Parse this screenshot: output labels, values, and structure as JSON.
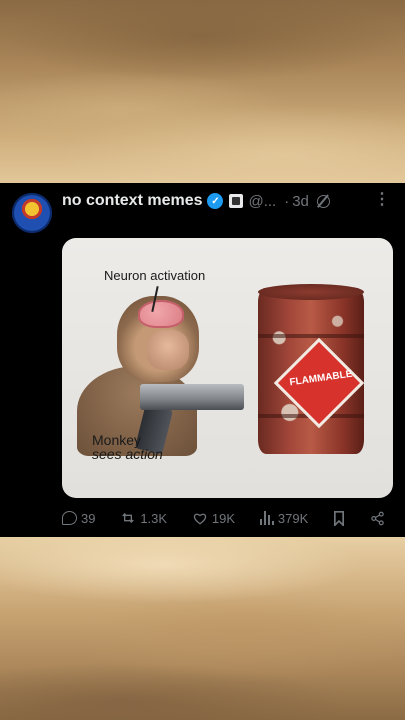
{
  "post": {
    "author_name": "no context memes",
    "handle": "@...",
    "separator": "·",
    "time": "3d",
    "more_label": "⋮",
    "media": {
      "caption_top": "Neuron activation",
      "caption_bottom_1": "Monkey",
      "caption_bottom_2": "sees action",
      "barrel_label": "FLAMMABLE"
    },
    "stats": {
      "replies": "39",
      "reposts": "1.3K",
      "likes": "19K",
      "views": "379K"
    }
  },
  "colors": {
    "verified": "#1d9bf0",
    "muted": "#71767b",
    "text": "#e7e9ea",
    "background": "#000000"
  },
  "icons": [
    "reply-icon",
    "repost-icon",
    "like-icon",
    "views-icon",
    "bookmark-icon",
    "share-icon",
    "verified-icon",
    "grok-icon",
    "more-icon"
  ]
}
